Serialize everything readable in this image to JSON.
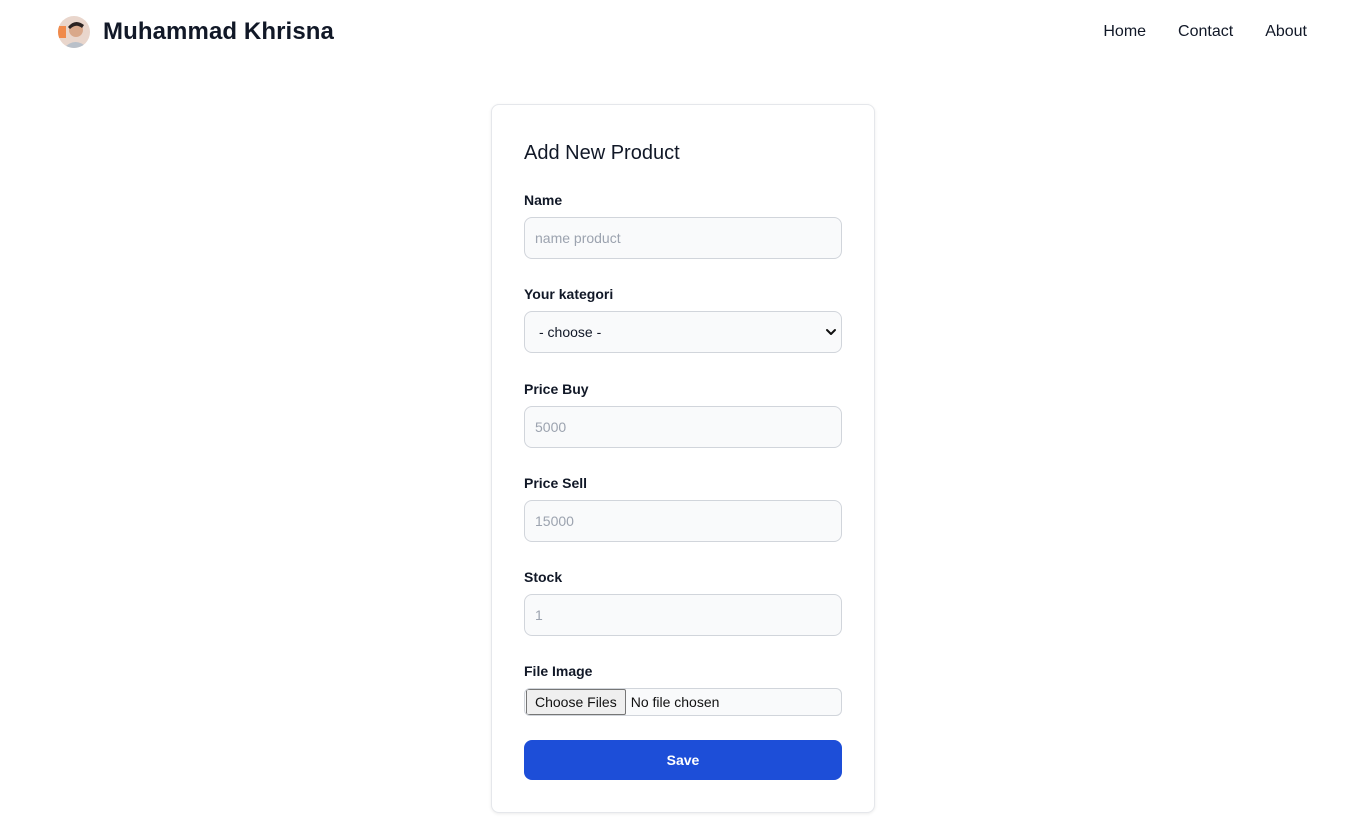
{
  "navbar": {
    "brand_name": "Muhammad Khrisna",
    "avatar_icon": "user-avatar-icon",
    "links": [
      {
        "label": "Home"
      },
      {
        "label": "Contact"
      },
      {
        "label": "About"
      }
    ]
  },
  "form": {
    "title": "Add New Product",
    "name": {
      "label": "Name",
      "placeholder": "name product",
      "value": ""
    },
    "category": {
      "label": "Your kategori",
      "selected": "- choose -"
    },
    "price_buy": {
      "label": "Price Buy",
      "placeholder": "5000",
      "value": ""
    },
    "price_sell": {
      "label": "Price Sell",
      "placeholder": "15000",
      "value": ""
    },
    "stock": {
      "label": "Stock",
      "placeholder": "1",
      "value": ""
    },
    "file_image": {
      "label": "File Image",
      "button_label": "Choose Files",
      "status": "No file chosen"
    },
    "save_label": "Save"
  },
  "colors": {
    "primary": "#1d4ed8",
    "input_bg": "#f9fafb",
    "input_border": "#d1d5db",
    "text": "#111827",
    "placeholder": "#9ca3af"
  }
}
